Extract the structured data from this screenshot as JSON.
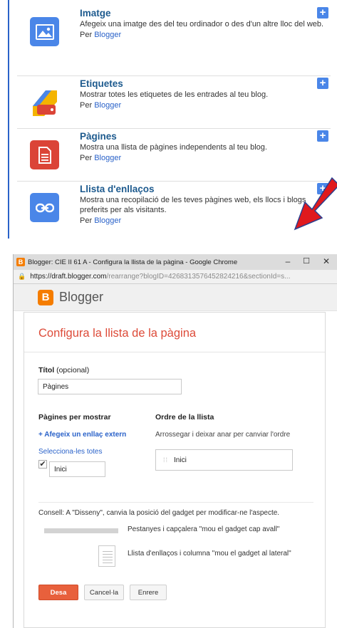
{
  "gadgets": [
    {
      "title": "Imatge",
      "description": "Afegeix una imatge des del teu ordinador o des d'un altre lloc del web.",
      "by_prefix": "Per",
      "by_author": "Blogger",
      "icon": "image-icon",
      "color": "#4a86e8"
    },
    {
      "title": "Etiquetes",
      "description": "Mostrar totes les etiquetes de les entrades al teu blog.",
      "by_prefix": "Per",
      "by_author": "Blogger",
      "icon": "label-icon",
      "color": "#f4b400"
    },
    {
      "title": "Pàgines",
      "description": "Mostra una llista de pàgines independents al teu blog.",
      "by_prefix": "Per",
      "by_author": "Blogger",
      "icon": "pages-icon",
      "color": "#db4437"
    },
    {
      "title": "Llista d'enllaços",
      "description": "Mostra una recopilació de les teves pàgines web, els llocs i blogs preferits per als visitants.",
      "by_prefix": "Per",
      "by_author": "Blogger",
      "icon": "link-icon",
      "color": "#4a86e8"
    }
  ],
  "add_button_label": "+",
  "window": {
    "title": "Blogger: CIE II 61 A - Configura la llista de la pàgina - Google Chrome",
    "minimize": "–",
    "maximize": "☐",
    "close": "✕",
    "url_host": "https://draft.blogger.com",
    "url_path": "/rearrange?blogID=4268313576452824216&sectionId=s..."
  },
  "blogger": {
    "logo_letter": "B",
    "name": "Blogger"
  },
  "dialog": {
    "title": "Configura la llista de la pàgina",
    "title_label": "Títol",
    "title_label_suffix": "(opcional)",
    "title_value": "Pàgines",
    "pages_heading": "Pàgines per mostrar",
    "add_external_link": "+ Afegeix un enllaç extern",
    "select_all": "Selecciona-les totes",
    "page_item": "Inici",
    "order_heading": "Ordre de la llista",
    "order_hint": "Arrossegar i deixar anar per canviar l'ordre",
    "order_item": "Inici",
    "tip": "Consell: A \"Disseny\", canvia la posició del gadget per modificar-ne l'aspecte.",
    "tip_tabs": "Pestanyes i capçalera \"mou el gadget cap avall\"",
    "tip_list": "Llista d'enllaços i columna \"mou el gadget al lateral\"",
    "save": "Desa",
    "cancel": "Cancel·la",
    "back": "Enrere"
  },
  "colors": {
    "accent_blue": "#2a62c9",
    "blogger_orange": "#f57d00",
    "title_red": "#dd4b39",
    "arrow_red": "#e0191d"
  }
}
